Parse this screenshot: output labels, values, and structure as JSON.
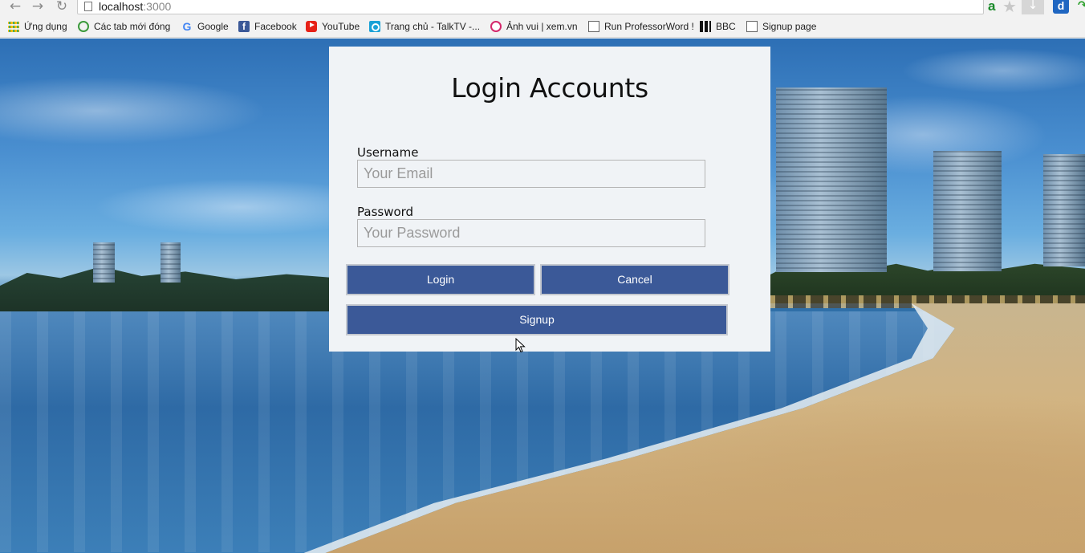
{
  "browser": {
    "url_host": "localhost",
    "url_port": ":3000",
    "extension_a_label": "a",
    "extension_blue_label": "d"
  },
  "bookmarks": [
    {
      "label": "Ứng dụng",
      "icon": "apps-grid-icon"
    },
    {
      "label": "Các tab mới đóng",
      "icon": "recent-tabs-icon"
    },
    {
      "label": "Google",
      "icon": "google-icon"
    },
    {
      "label": "Facebook",
      "icon": "facebook-icon"
    },
    {
      "label": "YouTube",
      "icon": "youtube-icon"
    },
    {
      "label": "Trang chủ - TalkTV -...",
      "icon": "talktv-icon"
    },
    {
      "label": "Ảnh vui | xem.vn",
      "icon": "xem-icon"
    },
    {
      "label": "Run ProfessorWord !",
      "icon": "page-icon"
    },
    {
      "label": "BBC",
      "icon": "bbc-icon"
    },
    {
      "label": "Signup page",
      "icon": "page-icon"
    }
  ],
  "login": {
    "title": "Login Accounts",
    "username_label": "Username",
    "username_placeholder": "Your Email",
    "password_label": "Password",
    "password_placeholder": "Your Password",
    "login_button": "Login",
    "cancel_button": "Cancel",
    "signup_button": "Signup"
  },
  "colors": {
    "button": "#3b5998",
    "card_background": "#f0f3f6",
    "chrome_background": "#f2f2f2"
  }
}
